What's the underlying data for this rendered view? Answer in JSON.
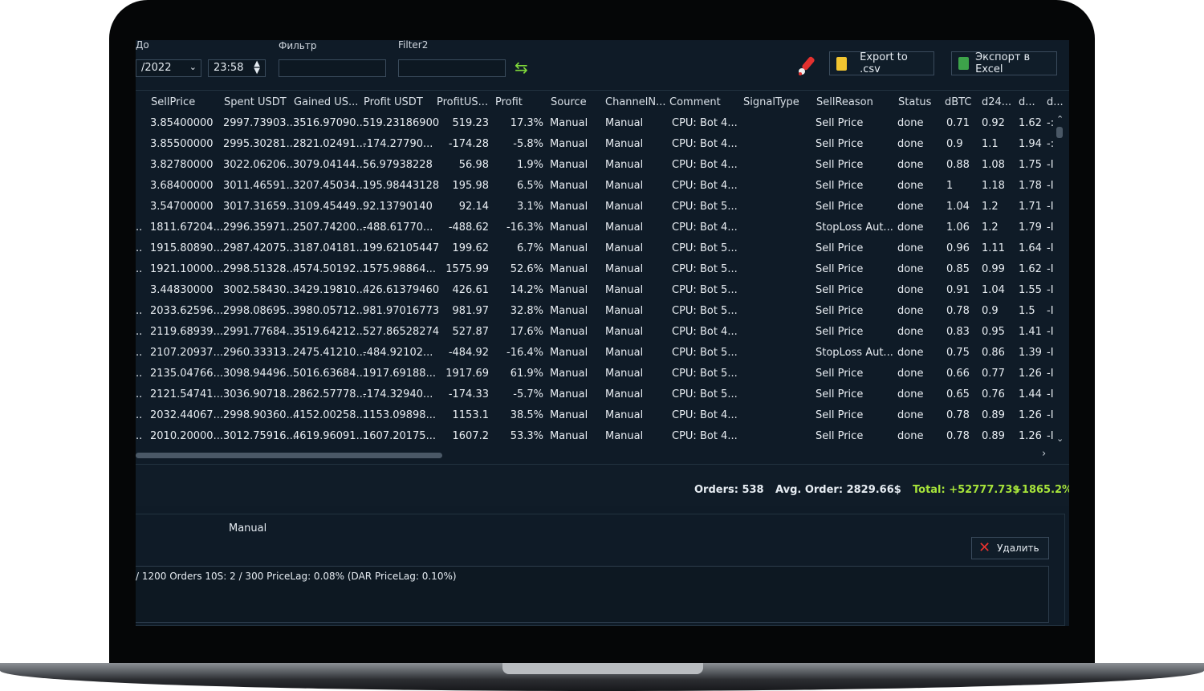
{
  "toolbar": {
    "date_to_label": "До",
    "date_value": "/2022",
    "time_value": "23:58",
    "filter_label": "Фильтр",
    "filter_value": "",
    "filter2_label": "Filter2",
    "filter2_value": "",
    "export_csv_label": "Export to .csv",
    "export_excel_label": "Экспорт в Excel"
  },
  "table": {
    "columns": [
      "SellPrice",
      "Spent USDT",
      "Gained US...",
      "Profit USDT",
      "ProfitUS...",
      "Profit",
      "Source",
      "ChannelN...",
      "Comment",
      "SignalType",
      "SellReason",
      "Status",
      "dBTC",
      "d24...",
      "d...",
      "d..."
    ],
    "rows": [
      {
        "prefix": "",
        "sell": "3.85400000",
        "spent": "2997.73903...",
        "gained": "3516.97090...",
        "profit_usdt": "519.23186900",
        "profit_us": "519.23",
        "profit": "17.3%",
        "source": "Manual",
        "channel": "Manual",
        "comment": "CPU: Bot 4...",
        "signal": "",
        "reason": "Sell Price",
        "status": "done",
        "dbtc": "0.71",
        "d24": "0.92",
        "d1": "1.62",
        "d2": "-:"
      },
      {
        "prefix": "",
        "sell": "3.85500000",
        "spent": "2995.30281...",
        "gained": "2821.02491...",
        "profit_usdt": "-174.27790...",
        "profit_us": "-174.28",
        "profit": "-5.8%",
        "source": "Manual",
        "channel": "Manual",
        "comment": "CPU: Bot 4...",
        "signal": "",
        "reason": "Sell Price",
        "status": "done",
        "dbtc": "0.9",
        "d24": "1.1",
        "d1": "1.94",
        "d2": "-:"
      },
      {
        "prefix": "",
        "sell": "3.82780000",
        "spent": "3022.06206...",
        "gained": "3079.04144...",
        "profit_usdt": "56.97938228",
        "profit_us": "56.98",
        "profit": "1.9%",
        "source": "Manual",
        "channel": "Manual",
        "comment": "CPU: Bot 4...",
        "signal": "",
        "reason": "Sell Price",
        "status": "done",
        "dbtc": "0.88",
        "d24": "1.08",
        "d1": "1.75",
        "d2": "-I"
      },
      {
        "prefix": "",
        "sell": "3.68400000",
        "spent": "3011.46591...",
        "gained": "3207.45034...",
        "profit_usdt": "195.98443128",
        "profit_us": "195.98",
        "profit": "6.5%",
        "source": "Manual",
        "channel": "Manual",
        "comment": "CPU: Bot 4...",
        "signal": "",
        "reason": "Sell Price",
        "status": "done",
        "dbtc": "1",
        "d24": "1.18",
        "d1": "1.78",
        "d2": "-I"
      },
      {
        "prefix": "",
        "sell": "3.54700000",
        "spent": "3017.31659...",
        "gained": "3109.45449...",
        "profit_usdt": "92.13790140",
        "profit_us": "92.14",
        "profit": "3.1%",
        "source": "Manual",
        "channel": "Manual",
        "comment": "CPU: Bot 5...",
        "signal": "",
        "reason": "Sell Price",
        "status": "done",
        "dbtc": "1.04",
        "d24": "1.2",
        "d1": "1.71",
        "d2": "-I"
      },
      {
        "prefix": "..",
        "sell": "1811.67204...",
        "spent": "2996.35971...",
        "gained": "2507.74200...",
        "profit_usdt": "-488.61770...",
        "profit_us": "-488.62",
        "profit": "-16.3%",
        "source": "Manual",
        "channel": "Manual",
        "comment": "CPU: Bot 4...",
        "signal": "",
        "reason": "StopLoss Aut...",
        "status": "done",
        "dbtc": "1.06",
        "d24": "1.2",
        "d1": "1.79",
        "d2": "-I"
      },
      {
        "prefix": "..",
        "sell": "1915.80890...",
        "spent": "2987.42075...",
        "gained": "3187.04181...",
        "profit_usdt": "199.62105447",
        "profit_us": "199.62",
        "profit": "6.7%",
        "source": "Manual",
        "channel": "Manual",
        "comment": "CPU: Bot 5...",
        "signal": "",
        "reason": "Sell Price",
        "status": "done",
        "dbtc": "0.96",
        "d24": "1.11",
        "d1": "1.64",
        "d2": "-I"
      },
      {
        "prefix": "..",
        "sell": "1921.10000...",
        "spent": "2998.51328...",
        "gained": "4574.50192...",
        "profit_usdt": "1575.98864...",
        "profit_us": "1575.99",
        "profit": "52.6%",
        "source": "Manual",
        "channel": "Manual",
        "comment": "CPU: Bot 5...",
        "signal": "",
        "reason": "Sell Price",
        "status": "done",
        "dbtc": "0.85",
        "d24": "0.99",
        "d1": "1.62",
        "d2": "-I"
      },
      {
        "prefix": "",
        "sell": "3.44830000",
        "spent": "3002.58430...",
        "gained": "3429.19810...",
        "profit_usdt": "426.61379460",
        "profit_us": "426.61",
        "profit": "14.2%",
        "source": "Manual",
        "channel": "Manual",
        "comment": "CPU: Bot 5...",
        "signal": "",
        "reason": "Sell Price",
        "status": "done",
        "dbtc": "0.91",
        "d24": "1.04",
        "d1": "1.55",
        "d2": "-I"
      },
      {
        "prefix": "..",
        "sell": "2033.62596...",
        "spent": "2998.08695...",
        "gained": "3980.05712...",
        "profit_usdt": "981.97016773",
        "profit_us": "981.97",
        "profit": "32.8%",
        "source": "Manual",
        "channel": "Manual",
        "comment": "CPU: Bot 5...",
        "signal": "",
        "reason": "Sell Price",
        "status": "done",
        "dbtc": "0.78",
        "d24": "0.9",
        "d1": "1.5",
        "d2": "-I"
      },
      {
        "prefix": "..",
        "sell": "2119.68939...",
        "spent": "2991.77684...",
        "gained": "3519.64212...",
        "profit_usdt": "527.86528274",
        "profit_us": "527.87",
        "profit": "17.6%",
        "source": "Manual",
        "channel": "Manual",
        "comment": "CPU: Bot 4...",
        "signal": "",
        "reason": "Sell Price",
        "status": "done",
        "dbtc": "0.83",
        "d24": "0.95",
        "d1": "1.41",
        "d2": "-I"
      },
      {
        "prefix": "..",
        "sell": "2107.20937...",
        "spent": "2960.33313...",
        "gained": "2475.41210...",
        "profit_usdt": "-484.92102...",
        "profit_us": "-484.92",
        "profit": "-16.4%",
        "source": "Manual",
        "channel": "Manual",
        "comment": "CPU: Bot 5...",
        "signal": "",
        "reason": "StopLoss Aut...",
        "status": "done",
        "dbtc": "0.75",
        "d24": "0.86",
        "d1": "1.39",
        "d2": "-I"
      },
      {
        "prefix": "..",
        "sell": "2135.04766...",
        "spent": "3098.94496...",
        "gained": "5016.63684...",
        "profit_usdt": "1917.69188...",
        "profit_us": "1917.69",
        "profit": "61.9%",
        "source": "Manual",
        "channel": "Manual",
        "comment": "CPU: Bot 5...",
        "signal": "",
        "reason": "Sell Price",
        "status": "done",
        "dbtc": "0.66",
        "d24": "0.77",
        "d1": "1.26",
        "d2": "-I"
      },
      {
        "prefix": "..",
        "sell": "2121.54741...",
        "spent": "3036.90718...",
        "gained": "2862.57778...",
        "profit_usdt": "-174.32940...",
        "profit_us": "-174.33",
        "profit": "-5.7%",
        "source": "Manual",
        "channel": "Manual",
        "comment": "CPU: Bot 5...",
        "signal": "",
        "reason": "Sell Price",
        "status": "done",
        "dbtc": "0.65",
        "d24": "0.76",
        "d1": "1.44",
        "d2": "-I"
      },
      {
        "prefix": "..",
        "sell": "2032.44067...",
        "spent": "2998.90360...",
        "gained": "4152.00258...",
        "profit_usdt": "1153.09898...",
        "profit_us": "1153.1",
        "profit": "38.5%",
        "source": "Manual",
        "channel": "Manual",
        "comment": "CPU: Bot 4...",
        "signal": "",
        "reason": "Sell Price",
        "status": "done",
        "dbtc": "0.78",
        "d24": "0.89",
        "d1": "1.26",
        "d2": "-I"
      },
      {
        "prefix": "..",
        "sell": "2010.20000...",
        "spent": "3012.75916...",
        "gained": "4619.96091...",
        "profit_usdt": "1607.20175...",
        "profit_us": "1607.2",
        "profit": "53.3%",
        "source": "Manual",
        "channel": "Manual",
        "comment": "CPU: Bot 4...",
        "signal": "",
        "reason": "Sell Price",
        "status": "done",
        "dbtc": "0.78",
        "d24": "0.89",
        "d1": "1.26",
        "d2": "-I"
      }
    ]
  },
  "summary": {
    "orders": "Orders: 538",
    "avg_order": "Avg. Order: 2829.66$",
    "total": "Total: +52777.73$",
    "total_pct": "+1865.2%"
  },
  "detail": {
    "source_value": "Manual",
    "delete_label": "Удалить",
    "log_line": "/ 1200   Orders 10S: 2 / 300   PriceLag: 0.08% (DAR PriceLag: 0.10%)"
  },
  "colors": {
    "screen_bg": "#0f1b27",
    "profit_positive": "#b7e33a",
    "profit_negative": "#ff6a3a",
    "total_green": "#a6e33a"
  }
}
